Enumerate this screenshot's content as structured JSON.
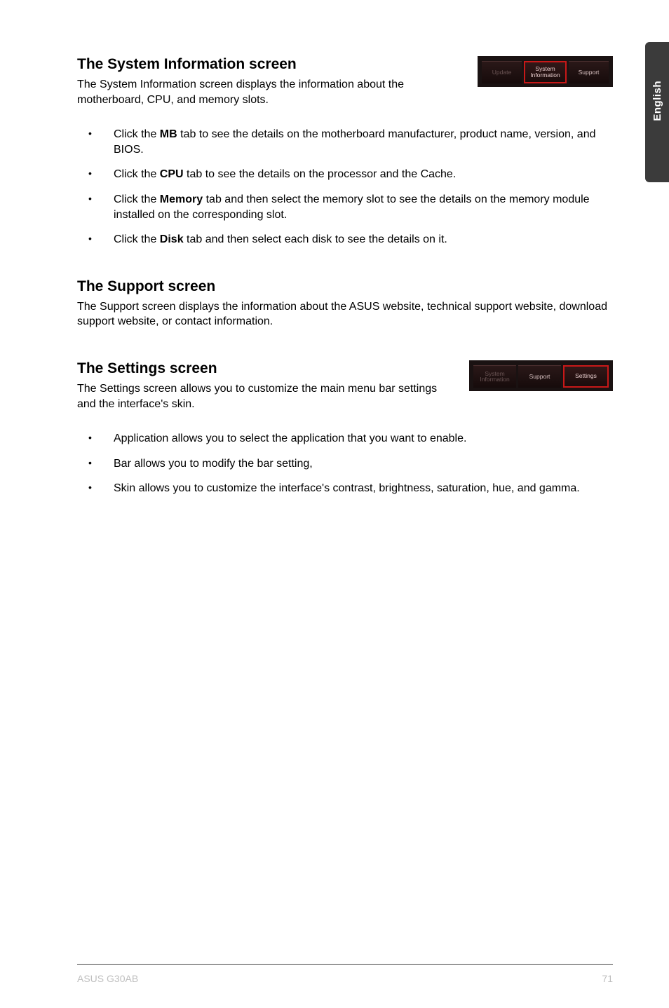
{
  "side_tab": {
    "label": "English"
  },
  "section_sysinfo": {
    "heading": "The System Information screen",
    "desc": "The System Information screen displays the information about the motherboard, CPU, and memory slots.",
    "tabs": {
      "update": "Update",
      "system_information": "System\nInformation",
      "support": "Support"
    },
    "bullets": [
      {
        "pre": "Click the ",
        "bold": "MB",
        "post": " tab to see the details on the motherboard manufacturer, product name, version, and BIOS."
      },
      {
        "pre": "Click the ",
        "bold": "CPU",
        "post": " tab to see the details on the processor and the Cache."
      },
      {
        "pre": "Click the ",
        "bold": "Memory",
        "post": " tab and then select the memory slot to see the details on the memory module installed on the corresponding slot."
      },
      {
        "pre": "Click the ",
        "bold": "Disk",
        "post": " tab and then select each disk to see the details on it."
      }
    ]
  },
  "section_support": {
    "heading": "The Support screen",
    "desc": "The Support screen displays the information about the ASUS website, technical support website, download support website, or contact information."
  },
  "section_settings": {
    "heading": "The Settings screen",
    "desc": "The Settings screen allows you to customize the main menu bar settings and the interface's skin.",
    "tabs": {
      "system_information": "System\nInformation",
      "support": "Support",
      "settings": "Settings"
    },
    "bullets": [
      "Application allows you to select the application that you want to enable.",
      "Bar allows you to modify the bar setting,",
      "Skin allows you to customize the interface's contrast, brightness, saturation, hue, and gamma."
    ]
  },
  "footer": {
    "left": "ASUS G30AB",
    "right": "71"
  }
}
